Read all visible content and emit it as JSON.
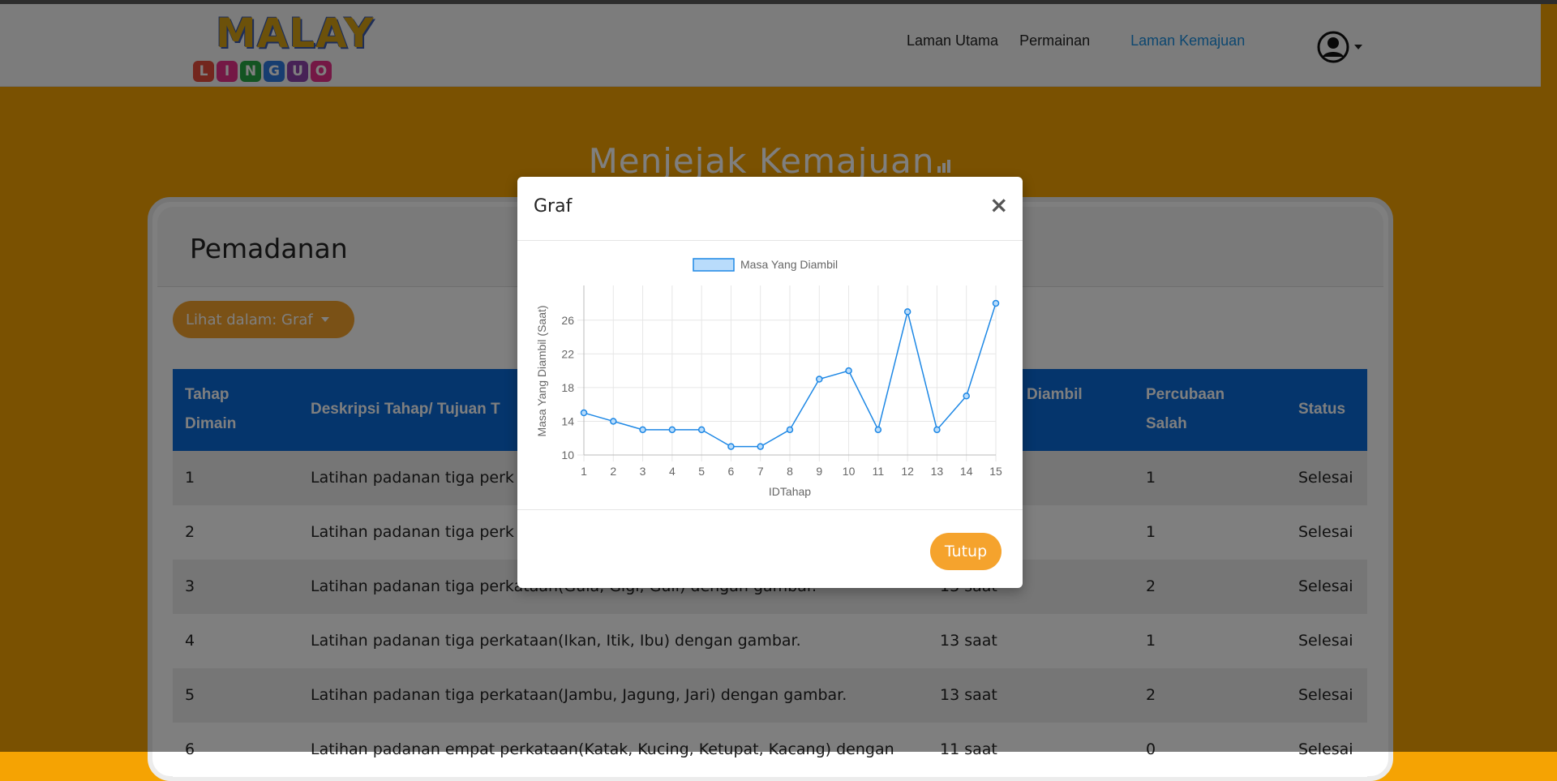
{
  "brand": {
    "word": "MALAY",
    "letters": [
      {
        "char": "L",
        "color": "#e74c3c"
      },
      {
        "char": "I",
        "color": "#e8308a"
      },
      {
        "char": "N",
        "color": "#27a844"
      },
      {
        "char": "G",
        "color": "#2f7be0"
      },
      {
        "char": "U",
        "color": "#8e44ad"
      },
      {
        "char": "O",
        "color": "#e8308a"
      }
    ]
  },
  "nav": {
    "home": "Laman Utama",
    "games": "Permainan",
    "progress": "Laman Kemajuan"
  },
  "page": {
    "title": "Menjejak Kemajuan",
    "section_title": "Pemadanan",
    "view_button": "Lihat dalam: Graf"
  },
  "table": {
    "headers": {
      "level": "Tahap\nDimain",
      "desc": "Deskripsi Tahap/ Tujuan T",
      "time": "Diambil",
      "wrong": "Percubaan\nSalah",
      "status": "Status"
    },
    "rows": [
      {
        "level": "1",
        "desc": "Latihan padanan tiga perk",
        "time": "",
        "wrong": "1",
        "status": "Selesai"
      },
      {
        "level": "2",
        "desc": "Latihan padanan tiga perk",
        "time": "",
        "wrong": "1",
        "status": "Selesai"
      },
      {
        "level": "3",
        "desc": "Latihan padanan tiga perkataan(Gula, Gigi, Guli) dengan gambar.",
        "time": "13 saat",
        "wrong": "2",
        "status": "Selesai"
      },
      {
        "level": "4",
        "desc": "Latihan padanan tiga perkataan(Ikan, Itik, Ibu) dengan gambar.",
        "time": "13 saat",
        "wrong": "1",
        "status": "Selesai"
      },
      {
        "level": "5",
        "desc": "Latihan padanan tiga perkataan(Jambu, Jagung, Jari) dengan gambar.",
        "time": "13 saat",
        "wrong": "2",
        "status": "Selesai"
      },
      {
        "level": "6",
        "desc": "Latihan padanan empat perkataan(Katak, Kucing, Ketupat, Kacang) dengan",
        "time": "11 saat",
        "wrong": "0",
        "status": "Selesai"
      }
    ]
  },
  "modal": {
    "title": "Graf",
    "close_symbol": "×",
    "close_button": "Tutup"
  },
  "chart_data": {
    "type": "line",
    "legend": "Masa Yang Diambil",
    "xlabel": "IDTahap",
    "ylabel": "Masa Yang Diambil (Saat)",
    "x": [
      1,
      2,
      3,
      4,
      5,
      6,
      7,
      8,
      9,
      10,
      11,
      12,
      13,
      14,
      15
    ],
    "y": [
      15,
      14,
      13,
      13,
      13,
      11,
      11,
      13,
      19,
      20,
      13,
      27,
      13,
      17,
      28
    ],
    "yticks": [
      10,
      14,
      18,
      22,
      26
    ],
    "ylim": [
      10,
      28
    ],
    "grid": true,
    "line_color": "#1e88e5",
    "fill_color": "#b9dcfb"
  }
}
